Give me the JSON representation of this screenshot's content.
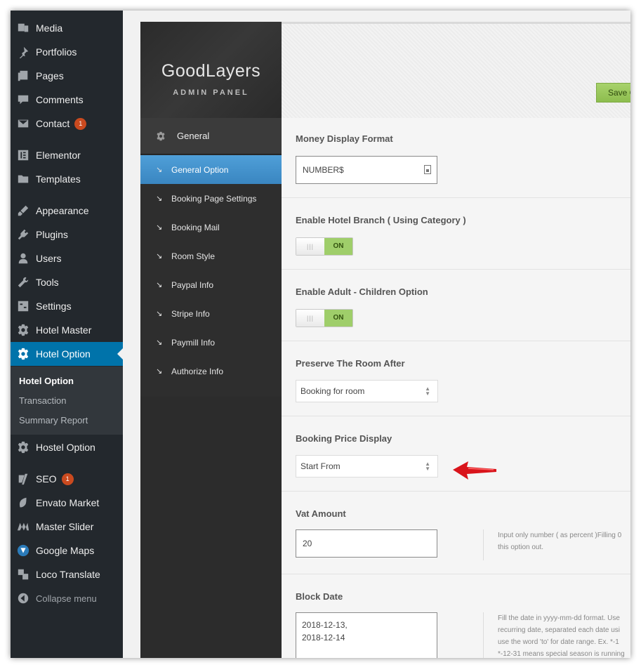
{
  "wp_menu": {
    "items": [
      {
        "label": "Media",
        "icon": "media-icon"
      },
      {
        "label": "Portfolios",
        "icon": "pin-icon"
      },
      {
        "label": "Pages",
        "icon": "pages-icon"
      },
      {
        "label": "Comments",
        "icon": "comments-icon"
      },
      {
        "label": "Contact",
        "icon": "mail-icon",
        "badge": "1"
      },
      {
        "label": "Elementor",
        "icon": "elementor-icon"
      },
      {
        "label": "Templates",
        "icon": "folder-icon"
      },
      {
        "label": "Appearance",
        "icon": "brush-icon"
      },
      {
        "label": "Plugins",
        "icon": "plugin-icon"
      },
      {
        "label": "Users",
        "icon": "user-icon"
      },
      {
        "label": "Tools",
        "icon": "wrench-icon"
      },
      {
        "label": "Settings",
        "icon": "settings-icon"
      },
      {
        "label": "Hotel Master",
        "icon": "gear-icon"
      },
      {
        "label": "Hotel Option",
        "icon": "gear-icon"
      },
      {
        "label": "Hostel Option",
        "icon": "gear-icon"
      },
      {
        "label": "SEO",
        "icon": "yoast-icon",
        "badge": "1"
      },
      {
        "label": "Envato Market",
        "icon": "leaf-icon"
      },
      {
        "label": "Master Slider",
        "icon": "slider-icon"
      },
      {
        "label": "Google Maps",
        "icon": "map-icon"
      },
      {
        "label": "Loco Translate",
        "icon": "translate-icon"
      },
      {
        "label": "Collapse menu",
        "icon": "collapse-icon"
      }
    ],
    "submenu": [
      "Hotel Option",
      "Transaction",
      "Summary Report"
    ]
  },
  "panel": {
    "brand": "GoodLayers",
    "brand_sub": "ADMIN PANEL",
    "section": "General",
    "nav": [
      "General Option",
      "Booking Page Settings",
      "Booking Mail",
      "Room Style",
      "Paypal Info",
      "Stripe Info",
      "Paymill Info",
      "Authorize Info"
    ],
    "save_label": "Save C"
  },
  "options": {
    "money_format": {
      "title": "Money Display Format",
      "value": "NUMBER$"
    },
    "hotel_branch": {
      "title": "Enable Hotel Branch ( Using Category )",
      "toggle_off": "|||",
      "toggle_on": "ON"
    },
    "adult_children": {
      "title": "Enable Adult - Children Option",
      "toggle_off": "|||",
      "toggle_on": "ON"
    },
    "preserve_room": {
      "title": "Preserve The Room After",
      "selected": "Booking for room"
    },
    "price_display": {
      "title": "Booking Price Display",
      "selected": "Start From"
    },
    "vat": {
      "title": "Vat Amount",
      "value": "20",
      "desc_line1": "Input only number ( as percent )Filling 0",
      "desc_line2": "this option out."
    },
    "block_date": {
      "title": "Block Date",
      "value": "2018-12-13,\n2018-12-14",
      "desc_line1": "Fill the date in yyyy-mm-dd format. Use",
      "desc_line2": "recurring date, separated each date usi",
      "desc_line3": "use the word 'to' for date range. Ex. *-1",
      "desc_line4": "*-12-31 means special season is running"
    }
  },
  "colors": {
    "wp_active": "#0073aa",
    "panel_active": "#4f9fd8",
    "toggle_on": "#9fce6a",
    "arrow": "#d9141b"
  }
}
